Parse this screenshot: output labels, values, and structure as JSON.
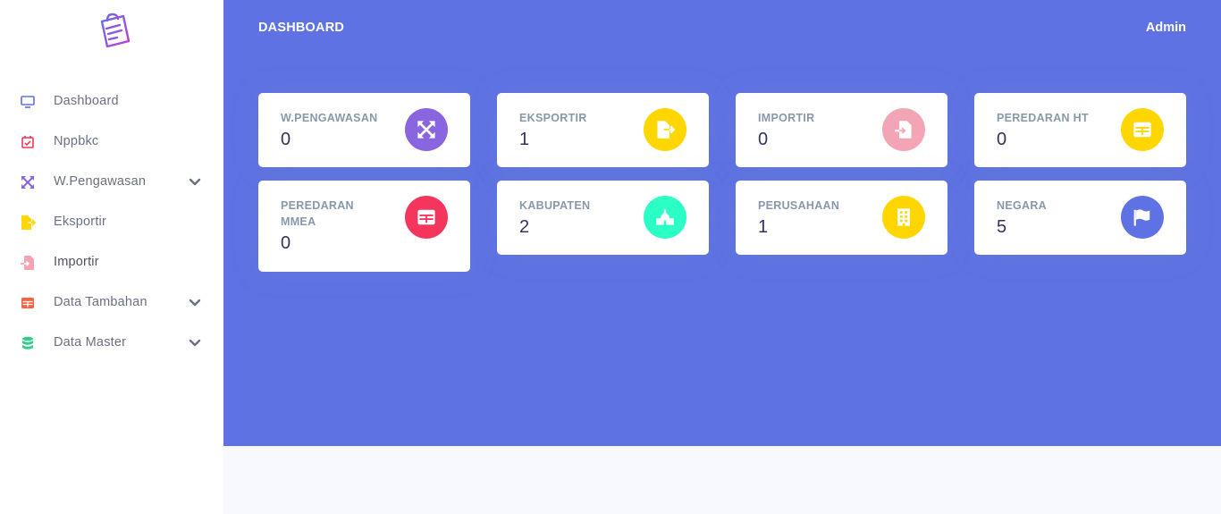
{
  "header": {
    "title": "DASHBOARD",
    "user": "Admin",
    "background_color": "#5e72e4"
  },
  "sidebar": {
    "logo_icon": "shopping-bag-icon",
    "items": [
      {
        "label": "Dashboard",
        "icon": "monitor-icon",
        "icon_color": "#5e72e4",
        "has_submenu": false
      },
      {
        "label": "Nppbkc",
        "icon": "calendar-check-icon",
        "icon_color": "#f5365c",
        "has_submenu": false
      },
      {
        "label": "W.Pengawasan",
        "icon": "arrows-expand-icon",
        "icon_color": "#8965e0",
        "has_submenu": true
      },
      {
        "label": "Eksportir",
        "icon": "file-export-icon",
        "icon_color": "#ffd600",
        "has_submenu": false
      },
      {
        "label": "Importir",
        "icon": "file-import-icon",
        "icon_color": "#f3a4b5",
        "has_submenu": false
      },
      {
        "label": "Data Tambahan",
        "icon": "table-icon",
        "icon_color": "#fb6340",
        "has_submenu": true
      },
      {
        "label": "Data Master",
        "icon": "database-icon",
        "icon_color": "#2dce89",
        "has_submenu": true
      }
    ]
  },
  "cards": [
    {
      "title": "W.PENGAWASAN",
      "value": "0",
      "icon": "arrows-expand-icon",
      "color": "#8965e0"
    },
    {
      "title": "EKSPORTIR",
      "value": "1",
      "icon": "file-export-icon",
      "color": "#ffd600"
    },
    {
      "title": "IMPORTIR",
      "value": "0",
      "icon": "file-import-icon",
      "color": "#f3a4b5"
    },
    {
      "title": "PEREDARAN HT",
      "value": "0",
      "icon": "table-icon",
      "color": "#ffd600"
    },
    {
      "title": "PEREDARAN MMEA",
      "value": "0",
      "icon": "table-icon",
      "color": "#f5365c"
    },
    {
      "title": "KABUPATEN",
      "value": "2",
      "icon": "building-columns-icon",
      "color": "#2bffc6"
    },
    {
      "title": "PERUSAHAAN",
      "value": "1",
      "icon": "building-icon",
      "color": "#ffd600"
    },
    {
      "title": "NEGARA",
      "value": "5",
      "icon": "flag-icon",
      "color": "#5e72e4"
    }
  ]
}
